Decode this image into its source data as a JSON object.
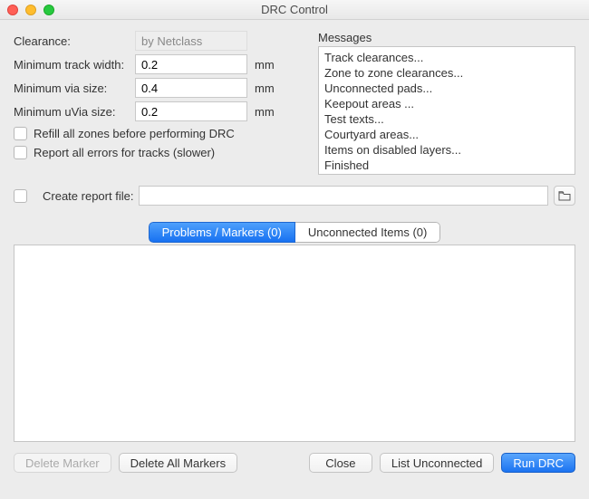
{
  "window": {
    "title": "DRC Control"
  },
  "form": {
    "clearance_label": "Clearance:",
    "clearance_value": "by Netclass",
    "min_track_label": "Minimum track width:",
    "min_track_value": "0.2",
    "min_via_label": "Minimum via size:",
    "min_via_value": "0.4",
    "min_uvia_label": "Minimum uVia size:",
    "min_uvia_value": "0.2",
    "unit": "mm",
    "refill_label": "Refill all zones before performing DRC",
    "report_all_label": "Report all errors for tracks (slower)"
  },
  "messages": {
    "label": "Messages",
    "items": [
      "Track clearances...",
      "Zone to zone clearances...",
      "Unconnected pads...",
      "Keepout areas ...",
      "Test texts...",
      "Courtyard areas...",
      "Items on disabled layers...",
      "Finished"
    ]
  },
  "report": {
    "checkbox_label": "Create report file:",
    "path": ""
  },
  "tabs": {
    "problems": "Problems / Markers (0)",
    "unconnected": "Unconnected Items (0)"
  },
  "buttons": {
    "delete_marker": "Delete Marker",
    "delete_all": "Delete All Markers",
    "close": "Close",
    "list_unconnected": "List Unconnected",
    "run": "Run DRC"
  }
}
